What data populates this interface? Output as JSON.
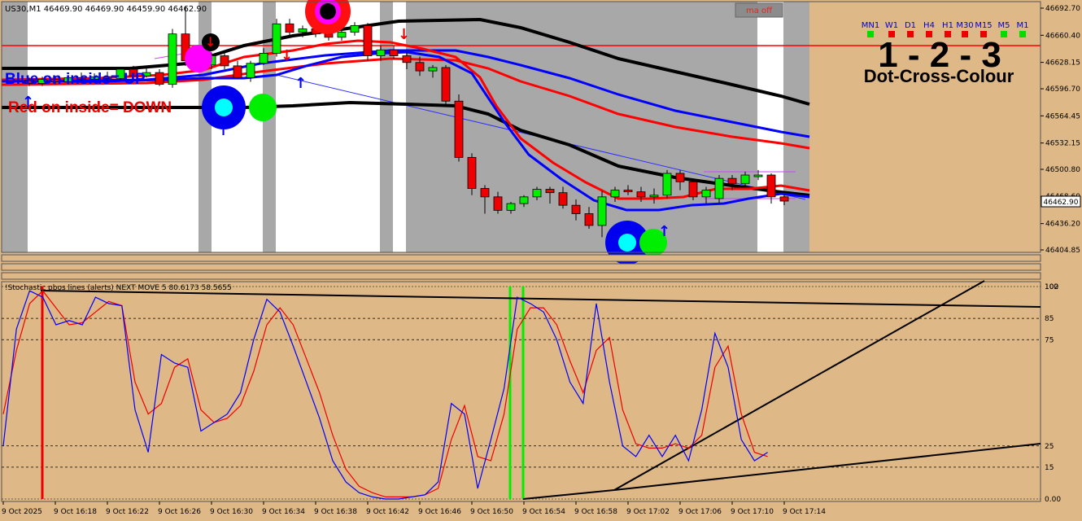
{
  "symbol_info": "US30,M1  46469.90 46469.90 46459.90 46462.90",
  "ma_button": "ma off",
  "price_tag": "46462.90",
  "price_axis": [
    "46692.70",
    "46660.40",
    "46628.15",
    "46596.70",
    "46564.45",
    "46532.15",
    "46500.80",
    "46468.60",
    "46436.20",
    "46404.85"
  ],
  "timeframes": [
    {
      "label": "MN1",
      "color": "#00dd00"
    },
    {
      "label": "W1",
      "color": "#ee0000"
    },
    {
      "label": "D1",
      "color": "#ee0000"
    },
    {
      "label": "H4",
      "color": "#ee0000"
    },
    {
      "label": "H1",
      "color": "#ee0000"
    },
    {
      "label": "M30",
      "color": "#ee0000"
    },
    {
      "label": "M15",
      "color": "#ee0000"
    },
    {
      "label": "M5",
      "color": "#00dd00"
    },
    {
      "label": "M1",
      "color": "#00dd00"
    }
  ],
  "big_title": "1 - 2 - 3",
  "big_subtitle": "Dot-Cross-Colour",
  "blue_label": "Blue on inside= UP",
  "red_label": "Red on inside= DOWN",
  "indicator_title": "!Stochastic pbos lines (alerts) NEXT MOVE 5 80.6173 58.5655",
  "indicator_axis": [
    {
      "label": "100",
      "v": 100
    },
    {
      "label": "102",
      "v": 102
    },
    {
      "label": "85",
      "v": 85
    },
    {
      "label": "75",
      "v": 75
    },
    {
      "label": "25",
      "v": 25
    },
    {
      "label": "15",
      "v": 15
    },
    {
      "label": "0.00",
      "v": 0
    }
  ],
  "time_axis": [
    "9 Oct 2025",
    "9 Oct 16:18",
    "9 Oct 16:22",
    "9 Oct 16:26",
    "9 Oct 16:30",
    "9 Oct 16:34",
    "9 Oct 16:38",
    "9 Oct 16:42",
    "9 Oct 16:46",
    "9 Oct 16:50",
    "9 Oct 16:54",
    "9 Oct 16:58",
    "9 Oct 17:02",
    "9 Oct 17:06",
    "9 Oct 17:10",
    "9 Oct 17:14"
  ],
  "colors": {
    "bull": "#00ee00",
    "bear": "#ee0000",
    "blue_ma": "#0000ff",
    "red_ma": "#ff0000",
    "panel_bg": "#deb887",
    "session_white": "#ffffff",
    "session_gray": "#a8a8a8"
  },
  "candles": [
    {
      "o": 46607,
      "h": 46610,
      "l": 46600,
      "c": 46603
    },
    {
      "o": 46603,
      "h": 46611,
      "l": 46600,
      "c": 46608
    },
    {
      "o": 46608,
      "h": 46612,
      "l": 46602,
      "c": 46605
    },
    {
      "o": 46605,
      "h": 46613,
      "l": 46602,
      "c": 46610
    },
    {
      "o": 46610,
      "h": 46616,
      "l": 46604,
      "c": 46608
    },
    {
      "o": 46608,
      "h": 46615,
      "l": 46604,
      "c": 46611
    },
    {
      "o": 46611,
      "h": 46617,
      "l": 46606,
      "c": 46609
    },
    {
      "o": 46609,
      "h": 46622,
      "l": 46607,
      "c": 46620
    },
    {
      "o": 46620,
      "h": 46624,
      "l": 46610,
      "c": 46612
    },
    {
      "o": 46612,
      "h": 46624,
      "l": 46610,
      "c": 46616
    },
    {
      "o": 46616,
      "h": 46620,
      "l": 46600,
      "c": 46602
    },
    {
      "o": 46602,
      "h": 46668,
      "l": 46598,
      "c": 46662
    },
    {
      "o": 46662,
      "h": 46695,
      "l": 46624,
      "c": 46630
    },
    {
      "o": 46630,
      "h": 46640,
      "l": 46620,
      "c": 46625
    },
    {
      "o": 46625,
      "h": 46640,
      "l": 46620,
      "c": 46636
    },
    {
      "o": 46636,
      "h": 46640,
      "l": 46620,
      "c": 46624
    },
    {
      "o": 46624,
      "h": 46630,
      "l": 46608,
      "c": 46610
    },
    {
      "o": 46610,
      "h": 46630,
      "l": 46605,
      "c": 46627
    },
    {
      "o": 46627,
      "h": 46645,
      "l": 46625,
      "c": 46639
    },
    {
      "o": 46639,
      "h": 46680,
      "l": 46635,
      "c": 46674
    },
    {
      "o": 46674,
      "h": 46680,
      "l": 46660,
      "c": 46664
    },
    {
      "o": 46664,
      "h": 46672,
      "l": 46658,
      "c": 46668
    },
    {
      "o": 46668,
      "h": 46672,
      "l": 46658,
      "c": 46662
    },
    {
      "o": 46662,
      "h": 46668,
      "l": 46654,
      "c": 46658
    },
    {
      "o": 46658,
      "h": 46668,
      "l": 46654,
      "c": 46664
    },
    {
      "o": 46664,
      "h": 46676,
      "l": 46660,
      "c": 46672
    },
    {
      "o": 46672,
      "h": 46675,
      "l": 46630,
      "c": 46636
    },
    {
      "o": 46636,
      "h": 46648,
      "l": 46630,
      "c": 46643
    },
    {
      "o": 46643,
      "h": 46648,
      "l": 46632,
      "c": 46636
    },
    {
      "o": 46636,
      "h": 46640,
      "l": 46620,
      "c": 46628
    },
    {
      "o": 46628,
      "h": 46635,
      "l": 46612,
      "c": 46618
    },
    {
      "o": 46618,
      "h": 46625,
      "l": 46610,
      "c": 46622
    },
    {
      "o": 46622,
      "h": 46625,
      "l": 46578,
      "c": 46582
    },
    {
      "o": 46582,
      "h": 46590,
      "l": 46510,
      "c": 46515
    },
    {
      "o": 46515,
      "h": 46520,
      "l": 46470,
      "c": 46478
    },
    {
      "o": 46478,
      "h": 46482,
      "l": 46448,
      "c": 46468
    },
    {
      "o": 46468,
      "h": 46474,
      "l": 46448,
      "c": 46452
    },
    {
      "o": 46452,
      "h": 46462,
      "l": 46448,
      "c": 46460
    },
    {
      "o": 46460,
      "h": 46470,
      "l": 46456,
      "c": 46468
    },
    {
      "o": 46468,
      "h": 46480,
      "l": 46464,
      "c": 46477
    },
    {
      "o": 46477,
      "h": 46480,
      "l": 46460,
      "c": 46473
    },
    {
      "o": 46473,
      "h": 46480,
      "l": 46454,
      "c": 46458
    },
    {
      "o": 46458,
      "h": 46465,
      "l": 46440,
      "c": 46448
    },
    {
      "o": 46448,
      "h": 46456,
      "l": 46430,
      "c": 46434
    },
    {
      "o": 46434,
      "h": 46475,
      "l": 46420,
      "c": 46468
    },
    {
      "o": 46468,
      "h": 46480,
      "l": 46462,
      "c": 46476
    },
    {
      "o": 46476,
      "h": 46482,
      "l": 46470,
      "c": 46474
    },
    {
      "o": 46474,
      "h": 46480,
      "l": 46462,
      "c": 46468
    },
    {
      "o": 46468,
      "h": 46478,
      "l": 46460,
      "c": 46470
    },
    {
      "o": 46470,
      "h": 46500,
      "l": 46466,
      "c": 46496
    },
    {
      "o": 46496,
      "h": 46500,
      "l": 46476,
      "c": 46486
    },
    {
      "o": 46486,
      "h": 46490,
      "l": 46464,
      "c": 46468
    },
    {
      "o": 46468,
      "h": 46480,
      "l": 46460,
      "c": 46476
    },
    {
      "o": 46466,
      "h": 46494,
      "l": 46460,
      "c": 46490
    },
    {
      "o": 46490,
      "h": 46494,
      "l": 46476,
      "c": 46484
    },
    {
      "o": 46484,
      "h": 46498,
      "l": 46480,
      "c": 46494
    },
    {
      "o": 46494,
      "h": 46500,
      "l": 46488,
      "c": 46494
    },
    {
      "o": 46494,
      "h": 46496,
      "l": 46460,
      "c": 46468
    },
    {
      "o": 46468,
      "h": 46470,
      "l": 46458,
      "c": 46463
    }
  ],
  "stoch_blue": [
    25,
    80,
    98,
    95,
    82,
    84,
    82,
    95,
    92,
    91,
    42,
    22,
    68,
    64,
    62,
    32,
    36,
    40,
    50,
    75,
    94,
    88,
    72,
    55,
    38,
    18,
    8,
    3,
    1,
    0,
    0,
    1,
    2,
    8,
    45,
    40,
    5,
    28,
    52,
    95,
    92,
    88,
    75,
    55,
    45,
    92,
    55,
    25,
    20,
    30,
    20,
    30,
    18,
    42,
    78,
    62,
    28,
    18,
    22
  ],
  "stoch_red": [
    40,
    70,
    92,
    98,
    90,
    82,
    83,
    88,
    93,
    91,
    55,
    40,
    45,
    62,
    66,
    42,
    36,
    38,
    44,
    60,
    82,
    90,
    82,
    66,
    50,
    30,
    14,
    6,
    3,
    1,
    1,
    1,
    2,
    5,
    28,
    44,
    20,
    18,
    40,
    80,
    90,
    90,
    82,
    65,
    50,
    70,
    76,
    42,
    26,
    24,
    24,
    26,
    24,
    30,
    62,
    72,
    40,
    22,
    20
  ]
}
